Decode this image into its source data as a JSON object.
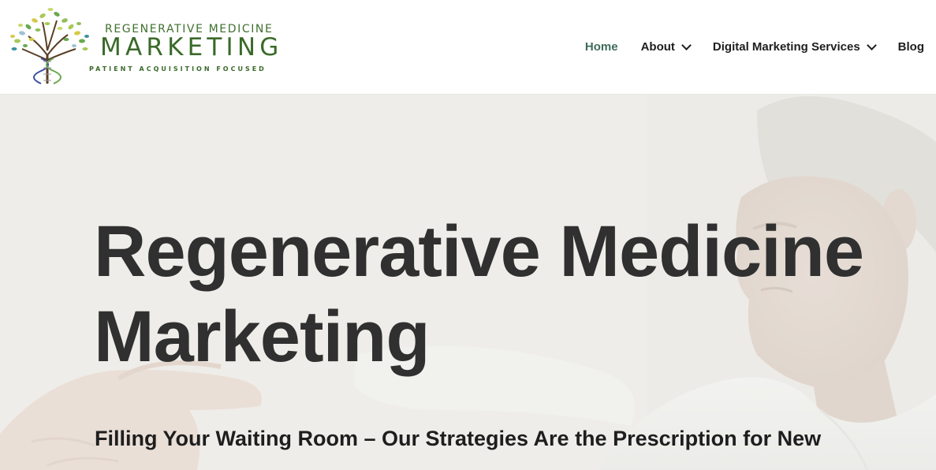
{
  "logo": {
    "line_top": "REGENERATIVE MEDICINE",
    "line_main": "MARKETING",
    "tagline": "PATIENT ACQUISITION FOCUSED",
    "icon": "tree-dna-icon"
  },
  "nav": {
    "items": [
      {
        "label": "Home",
        "active": true,
        "has_dropdown": false
      },
      {
        "label": "About",
        "active": false,
        "has_dropdown": true
      },
      {
        "label": "Digital Marketing Services",
        "active": false,
        "has_dropdown": true
      },
      {
        "label": "Blog",
        "active": false,
        "has_dropdown": false
      }
    ],
    "dropdown_icon": "chevron-down-icon"
  },
  "hero": {
    "title": "Regenerative Medicine Marketing",
    "subtitle": "Filling Your Waiting Room – Our Strategies Are the Prescription for New"
  },
  "colors": {
    "brand_green": "#3a6a2a",
    "nav_active": "#3f6b59",
    "nav_text": "#1e1e1e",
    "hero_title": "#303030",
    "hero_bg": "#eceae5"
  }
}
